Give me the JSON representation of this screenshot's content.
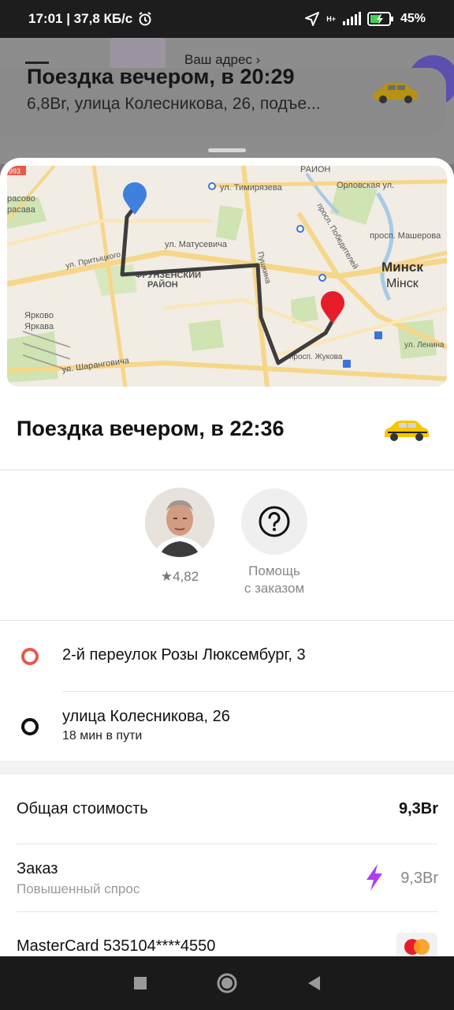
{
  "status": {
    "time_speed": "17:01 | 37,8 КБ/с",
    "network": "H+",
    "battery": "45%"
  },
  "background": {
    "address_link": "Ваш адрес",
    "card_title": "Поездка вечером, в 20:29",
    "card_subtitle": "6,8Br, улица Колесникова, 26, подъе..."
  },
  "map": {
    "labels": {
      "district_raion": "РАЙОН",
      "orlovskaya": "Орловская ул.",
      "timiryazeva": "ул. Тимирязева",
      "rasovo": "расово",
      "rasava": "расава",
      "matusevicha": "ул. Матусевича",
      "pushkina": "Пушкина",
      "pr_pobeditelei": "просп. Победителей",
      "pr_masherova": "просп. Машерова",
      "pritytskogo": "ул. Притыцкого",
      "frunzenskiy": "ФРУНЗЕНСКИЙ",
      "raion2": "РАЙОН",
      "minsk_ru": "Минск",
      "minsk_by": "Мінск",
      "yarkovo": "Ярково",
      "yarkava": "Яркава",
      "lenina": "ул. Ленина",
      "sharangovicha": "ул. Шаранговича",
      "zhukova": "просп. Жукова",
      "road_code": "993"
    }
  },
  "trip": {
    "title": "Поездка вечером, в 22:36",
    "rating": "4,82",
    "help_label": "Помощь с заказом"
  },
  "route": {
    "from": "2-й переулок Розы Люксембург, 3",
    "to": "улица Колесникова, 26",
    "duration": "18 мин в пути"
  },
  "cost": {
    "total_label": "Общая стоимость",
    "total_value": "9,3Br",
    "order_label": "Заказ",
    "order_sub": "Повышенный спрос",
    "order_value": "9,3Br",
    "card_label": "MasterCard 535104****4550"
  },
  "colors": {
    "surge": "#b13cf0",
    "origin": "#e45b4c",
    "route_line": "#3d3d3d",
    "taxi_yellow": "#f6c600"
  }
}
